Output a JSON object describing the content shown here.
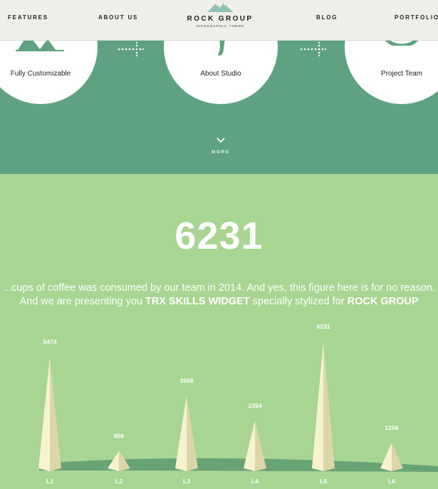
{
  "nav": {
    "features": "FEATURES",
    "about": "ABOUT US",
    "blog": "BLOG",
    "portfolio": "PORTFOLIO",
    "logo_title": "ROCK GROUP",
    "logo_subtitle": "INFOGRAPHIC THEME"
  },
  "hero": {
    "circles": [
      "Fully Customizable",
      "About Studio",
      "Project Team"
    ],
    "more": "MORE"
  },
  "stats": {
    "big_number": "6231",
    "line1": "...cups of coffee was consumed by our team in 2014. And yes, this figure here is for no reason.",
    "line2_prefix": "And we are presenting you ",
    "line2_strong1": "TRX SKILLS WIDGET",
    "line2_mid": " specially stylized for ",
    "line2_strong2": "ROCK GROUP"
  },
  "colors": {
    "nav_bg": "#efefea",
    "hero_bg": "#5fa281",
    "stats_bg": "#a8d592",
    "cone_light": "#f7f2cf",
    "cone_shade": "#ddd6a9",
    "shadow": "#5c9a72"
  },
  "chart_data": {
    "type": "bar",
    "categories": [
      "L1",
      "L2",
      "L3",
      "L4",
      "L5",
      "L6"
    ],
    "values": [
      5474,
      856,
      3568,
      2354,
      6231,
      1256
    ],
    "ylim": [
      0,
      6231
    ]
  }
}
